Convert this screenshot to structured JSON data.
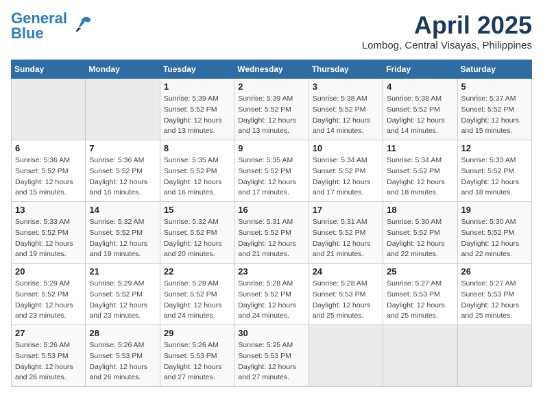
{
  "logo": {
    "line1": "General",
    "line2": "Blue"
  },
  "title": {
    "month_year": "April 2025",
    "location": "Lombog, Central Visayas, Philippines"
  },
  "days_of_week": [
    "Sunday",
    "Monday",
    "Tuesday",
    "Wednesday",
    "Thursday",
    "Friday",
    "Saturday"
  ],
  "weeks": [
    [
      {
        "day": "",
        "sunrise": "",
        "sunset": "",
        "daylight": ""
      },
      {
        "day": "",
        "sunrise": "",
        "sunset": "",
        "daylight": ""
      },
      {
        "day": "1",
        "sunrise": "Sunrise: 5:39 AM",
        "sunset": "Sunset: 5:52 PM",
        "daylight": "Daylight: 12 hours and 13 minutes."
      },
      {
        "day": "2",
        "sunrise": "Sunrise: 5:39 AM",
        "sunset": "Sunset: 5:52 PM",
        "daylight": "Daylight: 12 hours and 13 minutes."
      },
      {
        "day": "3",
        "sunrise": "Sunrise: 5:38 AM",
        "sunset": "Sunset: 5:52 PM",
        "daylight": "Daylight: 12 hours and 14 minutes."
      },
      {
        "day": "4",
        "sunrise": "Sunrise: 5:38 AM",
        "sunset": "Sunset: 5:52 PM",
        "daylight": "Daylight: 12 hours and 14 minutes."
      },
      {
        "day": "5",
        "sunrise": "Sunrise: 5:37 AM",
        "sunset": "Sunset: 5:52 PM",
        "daylight": "Daylight: 12 hours and 15 minutes."
      }
    ],
    [
      {
        "day": "6",
        "sunrise": "Sunrise: 5:36 AM",
        "sunset": "Sunset: 5:52 PM",
        "daylight": "Daylight: 12 hours and 15 minutes."
      },
      {
        "day": "7",
        "sunrise": "Sunrise: 5:36 AM",
        "sunset": "Sunset: 5:52 PM",
        "daylight": "Daylight: 12 hours and 16 minutes."
      },
      {
        "day": "8",
        "sunrise": "Sunrise: 5:35 AM",
        "sunset": "Sunset: 5:52 PM",
        "daylight": "Daylight: 12 hours and 16 minutes."
      },
      {
        "day": "9",
        "sunrise": "Sunrise: 5:35 AM",
        "sunset": "Sunset: 5:52 PM",
        "daylight": "Daylight: 12 hours and 17 minutes."
      },
      {
        "day": "10",
        "sunrise": "Sunrise: 5:34 AM",
        "sunset": "Sunset: 5:52 PM",
        "daylight": "Daylight: 12 hours and 17 minutes."
      },
      {
        "day": "11",
        "sunrise": "Sunrise: 5:34 AM",
        "sunset": "Sunset: 5:52 PM",
        "daylight": "Daylight: 12 hours and 18 minutes."
      },
      {
        "day": "12",
        "sunrise": "Sunrise: 5:33 AM",
        "sunset": "Sunset: 5:52 PM",
        "daylight": "Daylight: 12 hours and 18 minutes."
      }
    ],
    [
      {
        "day": "13",
        "sunrise": "Sunrise: 5:33 AM",
        "sunset": "Sunset: 5:52 PM",
        "daylight": "Daylight: 12 hours and 19 minutes."
      },
      {
        "day": "14",
        "sunrise": "Sunrise: 5:32 AM",
        "sunset": "Sunset: 5:52 PM",
        "daylight": "Daylight: 12 hours and 19 minutes."
      },
      {
        "day": "15",
        "sunrise": "Sunrise: 5:32 AM",
        "sunset": "Sunset: 5:52 PM",
        "daylight": "Daylight: 12 hours and 20 minutes."
      },
      {
        "day": "16",
        "sunrise": "Sunrise: 5:31 AM",
        "sunset": "Sunset: 5:52 PM",
        "daylight": "Daylight: 12 hours and 21 minutes."
      },
      {
        "day": "17",
        "sunrise": "Sunrise: 5:31 AM",
        "sunset": "Sunset: 5:52 PM",
        "daylight": "Daylight: 12 hours and 21 minutes."
      },
      {
        "day": "18",
        "sunrise": "Sunrise: 5:30 AM",
        "sunset": "Sunset: 5:52 PM",
        "daylight": "Daylight: 12 hours and 22 minutes."
      },
      {
        "day": "19",
        "sunrise": "Sunrise: 5:30 AM",
        "sunset": "Sunset: 5:52 PM",
        "daylight": "Daylight: 12 hours and 22 minutes."
      }
    ],
    [
      {
        "day": "20",
        "sunrise": "Sunrise: 5:29 AM",
        "sunset": "Sunset: 5:52 PM",
        "daylight": "Daylight: 12 hours and 23 minutes."
      },
      {
        "day": "21",
        "sunrise": "Sunrise: 5:29 AM",
        "sunset": "Sunset: 5:52 PM",
        "daylight": "Daylight: 12 hours and 23 minutes."
      },
      {
        "day": "22",
        "sunrise": "Sunrise: 5:28 AM",
        "sunset": "Sunset: 5:52 PM",
        "daylight": "Daylight: 12 hours and 24 minutes."
      },
      {
        "day": "23",
        "sunrise": "Sunrise: 5:28 AM",
        "sunset": "Sunset: 5:52 PM",
        "daylight": "Daylight: 12 hours and 24 minutes."
      },
      {
        "day": "24",
        "sunrise": "Sunrise: 5:28 AM",
        "sunset": "Sunset: 5:53 PM",
        "daylight": "Daylight: 12 hours and 25 minutes."
      },
      {
        "day": "25",
        "sunrise": "Sunrise: 5:27 AM",
        "sunset": "Sunset: 5:53 PM",
        "daylight": "Daylight: 12 hours and 25 minutes."
      },
      {
        "day": "26",
        "sunrise": "Sunrise: 5:27 AM",
        "sunset": "Sunset: 5:53 PM",
        "daylight": "Daylight: 12 hours and 25 minutes."
      }
    ],
    [
      {
        "day": "27",
        "sunrise": "Sunrise: 5:26 AM",
        "sunset": "Sunset: 5:53 PM",
        "daylight": "Daylight: 12 hours and 26 minutes."
      },
      {
        "day": "28",
        "sunrise": "Sunrise: 5:26 AM",
        "sunset": "Sunset: 5:53 PM",
        "daylight": "Daylight: 12 hours and 26 minutes."
      },
      {
        "day": "29",
        "sunrise": "Sunrise: 5:26 AM",
        "sunset": "Sunset: 5:53 PM",
        "daylight": "Daylight: 12 hours and 27 minutes."
      },
      {
        "day": "30",
        "sunrise": "Sunrise: 5:25 AM",
        "sunset": "Sunset: 5:53 PM",
        "daylight": "Daylight: 12 hours and 27 minutes."
      },
      {
        "day": "",
        "sunrise": "",
        "sunset": "",
        "daylight": ""
      },
      {
        "day": "",
        "sunrise": "",
        "sunset": "",
        "daylight": ""
      },
      {
        "day": "",
        "sunrise": "",
        "sunset": "",
        "daylight": ""
      }
    ]
  ]
}
